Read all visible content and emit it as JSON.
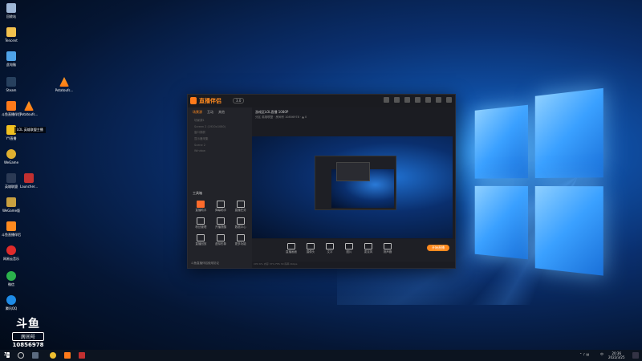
{
  "desktop": {
    "icons": [
      {
        "label": "回收站"
      },
      {
        "label": "Tencent"
      },
      {
        "label": "此电脑"
      },
      {
        "label": "Steam"
      },
      {
        "label": "斗鱼直播伴侣"
      },
      {
        "label": "YY直播"
      },
      {
        "label": "WeGame"
      },
      {
        "label": "英雄联盟"
      },
      {
        "label": "WeGame版"
      },
      {
        "label": "斗鱼直播伴侣"
      },
      {
        "label": "网易云音乐"
      },
      {
        "label": "微信"
      },
      {
        "label": "腾讯QQ"
      }
    ],
    "vlc_top_label": "Potatoufs...",
    "vlc_left_label": "Potatoufs...",
    "lol_label": "Launcher...",
    "tooltip": "LOL 英雄联盟主播",
    "watermark": {
      "logo": "斗鱼",
      "tag": "房间号",
      "room": "10856978"
    }
  },
  "app": {
    "brand": "直播伴侣",
    "version": "3.0",
    "left_tabs": [
      "场景源",
      "互动",
      "其他"
    ],
    "sources": [
      "场景源1",
      "Screen 2 (1920x1080)",
      "窗口捕获",
      "显示器采集",
      "Scene 2",
      "Window"
    ],
    "tools_header": "工具箱",
    "tools": [
      {
        "label": "直播助手",
        "red": true
      },
      {
        "label": "弹幕助手",
        "red": false
      },
      {
        "label": "直播任务",
        "red": false
      },
      {
        "label": "粉丝管理",
        "red": false
      },
      {
        "label": "开播提醒",
        "red": false
      },
      {
        "label": "数据中心",
        "red": false
      },
      {
        "label": "直播回放",
        "red": false
      },
      {
        "label": "虚拟形象",
        "red": false
      },
      {
        "label": "更多功能",
        "red": false
      }
    ],
    "notice": "斗鱼直播伴侣使用协议",
    "room_title": "游戏区LOL直播 1080P",
    "room_meta": "分区 英雄联盟  ·  房间号 10856978  ·  ▲ 0",
    "bottom_items": [
      "直播画面",
      "摄像头",
      "文字",
      "图片",
      "麦克风",
      "扬声器"
    ],
    "start_label": "开始直播",
    "status": "CPU 6%  内存 37%  FPS 30  码率 0kbps"
  },
  "taskbar": {
    "time": "20:36",
    "date": "2022/3/25",
    "lang": "中"
  }
}
